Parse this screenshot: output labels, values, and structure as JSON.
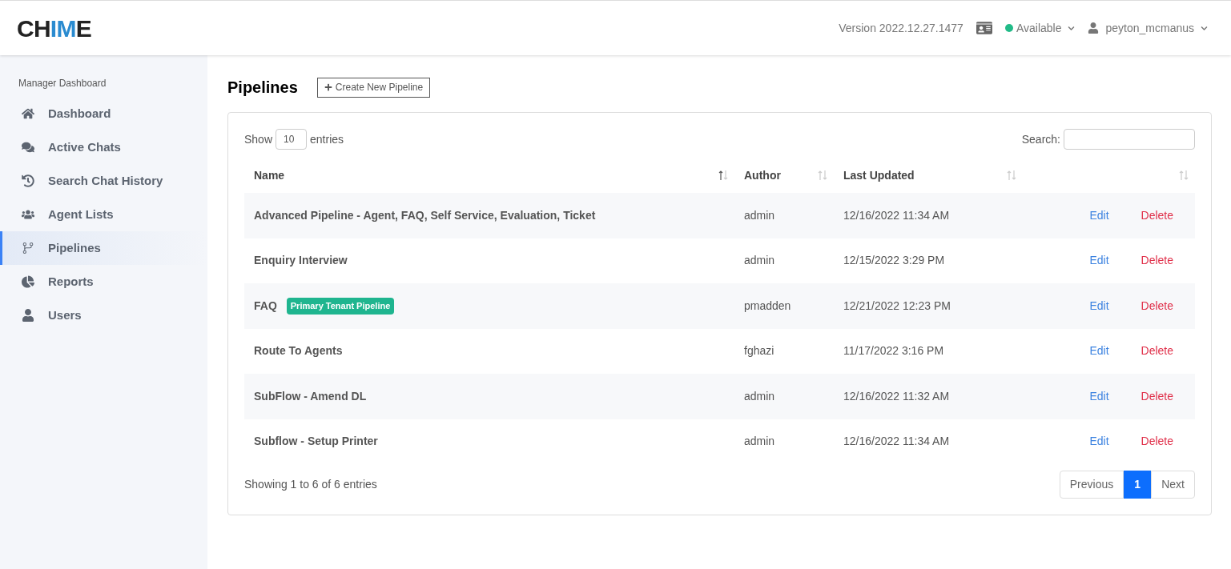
{
  "header": {
    "logo": [
      {
        "text": "CH",
        "accent": false
      },
      {
        "text": "IM",
        "accent": true
      },
      {
        "text": "E",
        "accent": false
      }
    ],
    "version": "Version 2022.12.27.1477",
    "status": {
      "label": "Available",
      "color": "#22bb88"
    },
    "user": "peyton_mcmanus"
  },
  "sidebar": {
    "heading": "Manager Dashboard",
    "items": [
      {
        "label": "Dashboard",
        "kind": "home",
        "selected": false
      },
      {
        "label": "Active Chats",
        "kind": "chats",
        "selected": false
      },
      {
        "label": "Search Chat History",
        "kind": "history",
        "selected": false
      },
      {
        "label": "Agent Lists",
        "kind": "agents",
        "selected": false
      },
      {
        "label": "Pipelines",
        "kind": "pipelines",
        "selected": true
      },
      {
        "label": "Reports",
        "kind": "reports",
        "selected": false
      },
      {
        "label": "Users",
        "kind": "users",
        "selected": false
      }
    ]
  },
  "page": {
    "title": "Pipelines",
    "create_button": "Create New Pipeline"
  },
  "table": {
    "show_label": "Show",
    "page_size": "10",
    "entries_label": "entries",
    "search_label": "Search:",
    "columns": [
      {
        "label": "Name",
        "sorted": true
      },
      {
        "label": "Author",
        "sorted": false
      },
      {
        "label": "Last Updated",
        "sorted": false
      },
      {
        "sorted": false
      }
    ],
    "rows": [
      {
        "name": "Advanced Pipeline - Agent, FAQ, Self Service, Evaluation, Ticket",
        "author": "admin",
        "updated": "12/16/2022 11:34 AM",
        "edit": "Edit",
        "delete": "Delete"
      },
      {
        "name": "Enquiry Interview",
        "author": "admin",
        "updated": "12/15/2022 3:29 PM",
        "edit": "Edit",
        "delete": "Delete"
      },
      {
        "name": "FAQ",
        "badge": "Primary Tenant Pipeline",
        "author": "pmadden",
        "updated": "12/21/2022 12:23 PM",
        "edit": "Edit",
        "delete": "Delete"
      },
      {
        "name": "Route To Agents",
        "author": "fghazi",
        "updated": "11/17/2022 3:16 PM",
        "edit": "Edit",
        "delete": "Delete"
      },
      {
        "name": "SubFlow - Amend DL",
        "author": "admin",
        "updated": "12/16/2022 11:32 AM",
        "edit": "Edit",
        "delete": "Delete"
      },
      {
        "name": "Subflow - Setup Printer",
        "author": "admin",
        "updated": "12/16/2022 11:34 AM",
        "edit": "Edit",
        "delete": "Delete"
      }
    ],
    "info": "Showing 1 to 6 of 6 entries",
    "pagination": {
      "previous": "Previous",
      "pages": [
        {
          "label": "1",
          "selected": true
        }
      ],
      "next": "Next"
    }
  }
}
